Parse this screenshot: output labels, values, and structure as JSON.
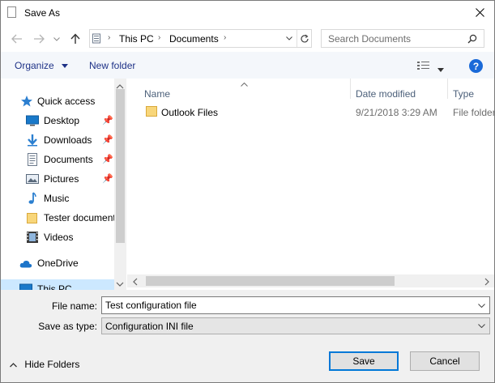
{
  "window": {
    "title": "Save As"
  },
  "address": {
    "crumbs": [
      "This PC",
      "Documents"
    ]
  },
  "search": {
    "placeholder": "Search Documents"
  },
  "toolbar": {
    "organize_label": "Organize",
    "new_folder_label": "New folder"
  },
  "nav": {
    "items": [
      {
        "label": "Quick access",
        "icon": "star-icon",
        "pinned": false
      },
      {
        "label": "Desktop",
        "icon": "desktop-icon",
        "pinned": true
      },
      {
        "label": "Downloads",
        "icon": "download-icon",
        "pinned": true
      },
      {
        "label": "Documents",
        "icon": "document-icon",
        "pinned": true
      },
      {
        "label": "Pictures",
        "icon": "picture-icon",
        "pinned": true
      },
      {
        "label": "Music",
        "icon": "music-icon",
        "pinned": false
      },
      {
        "label": "Tester document",
        "icon": "folder-icon",
        "pinned": false
      },
      {
        "label": "Videos",
        "icon": "video-icon",
        "pinned": false
      },
      {
        "label": "OneDrive",
        "icon": "cloud-icon",
        "pinned": false
      },
      {
        "label": "This PC",
        "icon": "pc-icon",
        "pinned": false
      }
    ]
  },
  "columns": {
    "name": "Name",
    "date": "Date modified",
    "type": "Type"
  },
  "files": [
    {
      "name": "Outlook Files",
      "date": "9/21/2018 3:29 AM",
      "type": "File folder"
    }
  ],
  "form": {
    "filename_label": "File name:",
    "filename_value": "Test configuration file",
    "savetype_label": "Save as type:",
    "savetype_value": "Configuration INI file"
  },
  "footer": {
    "hide_folders_label": "Hide Folders",
    "save_label": "Save",
    "cancel_label": "Cancel"
  },
  "colors": {
    "accent": "#0078d7",
    "link": "#1e3287",
    "folder": "#e8c15a"
  }
}
